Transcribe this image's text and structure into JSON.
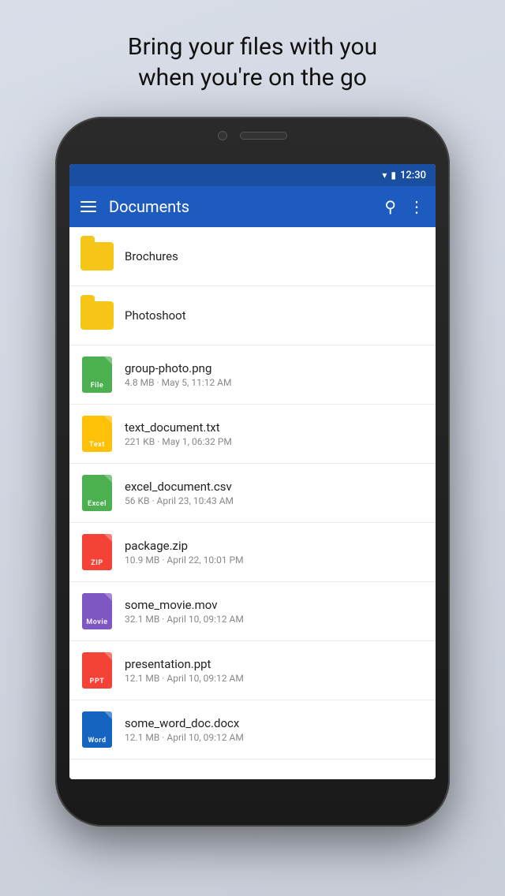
{
  "tagline": {
    "line1": "Bring your files with you",
    "line2": "when you're on the go"
  },
  "status_bar": {
    "time": "12:30"
  },
  "app_bar": {
    "title": "Documents"
  },
  "folders": [
    {
      "id": "brochures",
      "name": "Brochures"
    },
    {
      "id": "photoshoot",
      "name": "Photoshoot"
    }
  ],
  "files": [
    {
      "id": "f1",
      "name": "group-photo.png",
      "meta": "4.8 MB · May 5, 11:12 AM",
      "type": "File",
      "class": "icon-png"
    },
    {
      "id": "f2",
      "name": "text_document.txt",
      "meta": "221 KB · May 1, 06:32 PM",
      "type": "Text",
      "class": "icon-txt"
    },
    {
      "id": "f3",
      "name": "excel_document.csv",
      "meta": "56 KB · April 23, 10:43 AM",
      "type": "Excel",
      "class": "icon-csv"
    },
    {
      "id": "f4",
      "name": "package.zip",
      "meta": "10.9 MB · April 22, 10:01 PM",
      "type": "ZIP",
      "class": "icon-zip"
    },
    {
      "id": "f5",
      "name": "some_movie.mov",
      "meta": "32.1 MB · April 10, 09:12 AM",
      "type": "Movie",
      "class": "icon-mov"
    },
    {
      "id": "f6",
      "name": "presentation.ppt",
      "meta": "12.1 MB · April 10, 09:12 AM",
      "type": "PPT",
      "class": "icon-ppt"
    },
    {
      "id": "f7",
      "name": "some_word_doc.docx",
      "meta": "12.1 MB · April 10, 09:12 AM",
      "type": "Word",
      "class": "icon-docx"
    }
  ]
}
